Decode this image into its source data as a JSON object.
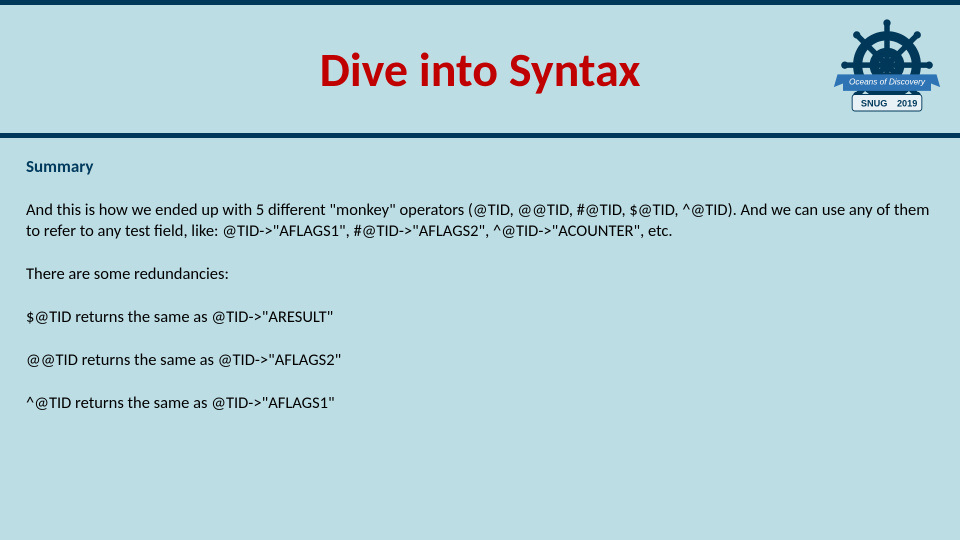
{
  "header": {
    "title": "Dive into Syntax",
    "logo": {
      "banner_text": "Oceans of Discovery",
      "org": "SNUG",
      "year": "2019"
    }
  },
  "body": {
    "summary_heading": "Summary",
    "p1": "And this is how we ended up with 5 different \"monkey\" operators (@TID, @@TID, #@TID, $@TID, ^@TID). And we can use any of them to refer to any test field, like: @TID->\"AFLAGS1\", #@TID->\"AFLAGS2\", ^@TID->\"ACOUNTER\", etc.",
    "p2": "There are some redundancies:",
    "p3": "$@TID returns the same as @TID->\"ARESULT\"",
    "p4": "@@TID returns the same as @TID->\"AFLAGS2\"",
    "p5": "^@TID returns the same as @TID->\"AFLAGS1\""
  }
}
